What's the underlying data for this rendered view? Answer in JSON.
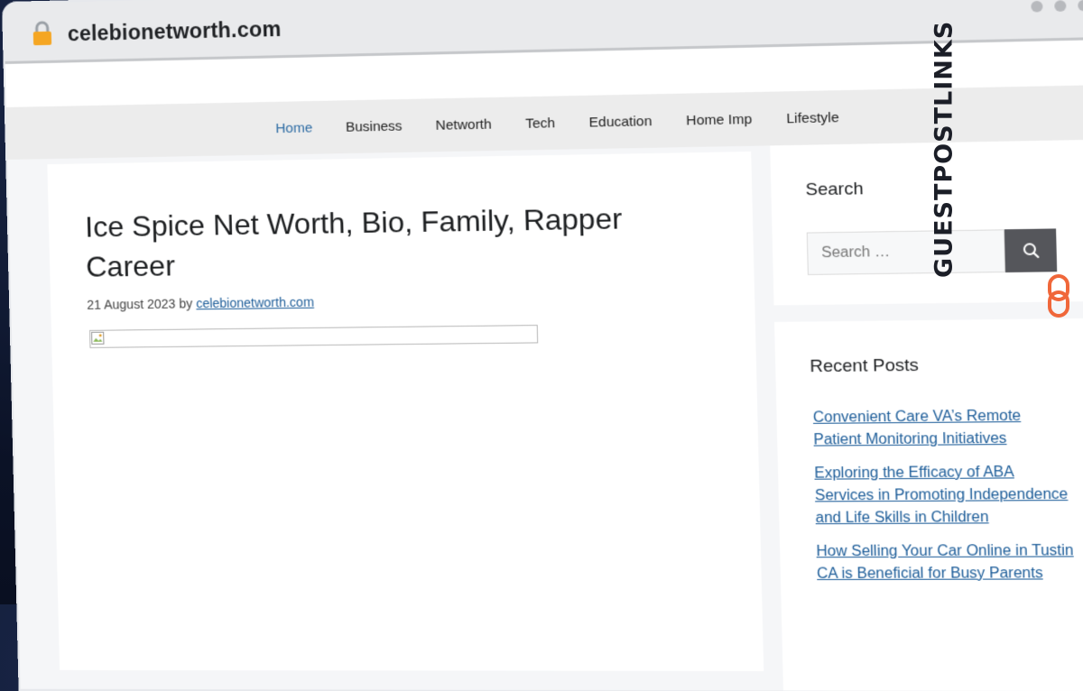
{
  "browser": {
    "url": "celebionetworth.com"
  },
  "nav": {
    "items": [
      {
        "label": "Home",
        "active": true
      },
      {
        "label": "Business",
        "active": false
      },
      {
        "label": "Networth",
        "active": false
      },
      {
        "label": "Tech",
        "active": false
      },
      {
        "label": "Education",
        "active": false
      },
      {
        "label": "Home Imp",
        "active": false
      },
      {
        "label": "Lifestyle",
        "active": false
      }
    ]
  },
  "article": {
    "title": "Ice Spice Net Worth, Bio, Family, Rapper Career",
    "date": "21 August 2023",
    "by": "by",
    "author": "celebionetworth.com"
  },
  "sidebar": {
    "search": {
      "title": "Search",
      "placeholder": "Search …"
    },
    "recent": {
      "title": "Recent Posts",
      "posts": [
        "Convenient Care VA’s Remote Patient Monitoring Initiatives",
        "Exploring the Efficacy of ABA Services in Promoting Independence and Life Skills in Children",
        "How Selling Your Car Online in Tustin CA is Beneficial for Busy Parents"
      ]
    }
  },
  "brand": {
    "name": "GUESTPOSTLINKS"
  },
  "colors": {
    "link": "#1d5d99",
    "nav_active": "#2e6ca4",
    "search_button": "#55565b",
    "brand_accent": "#f0673a"
  },
  "icons": {
    "lock": "lock-icon",
    "search": "search-icon",
    "brand_logo": "chain-link-icon"
  }
}
